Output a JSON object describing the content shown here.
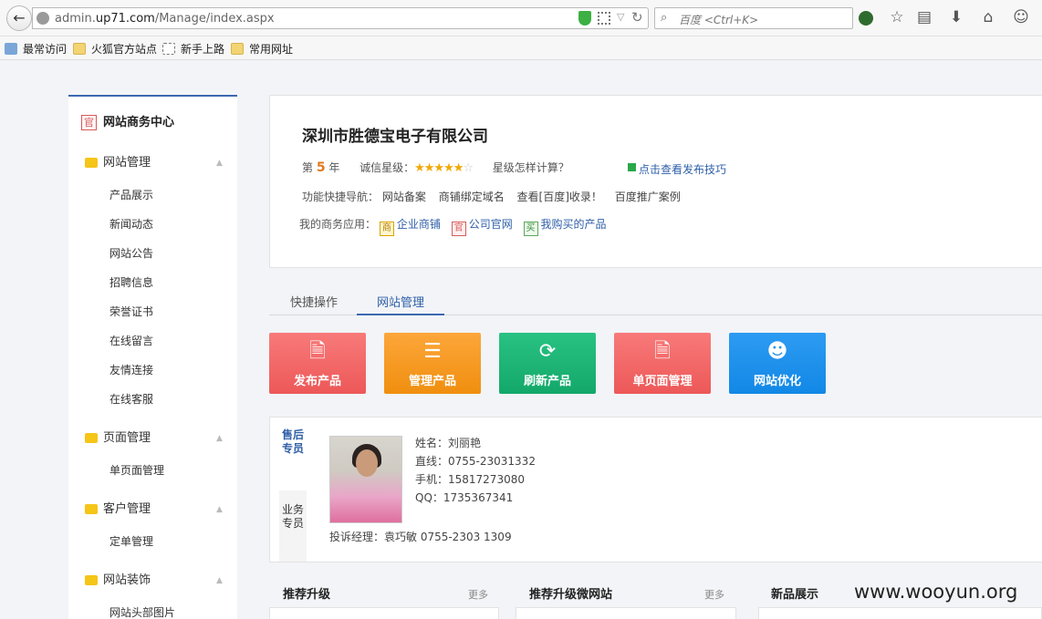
{
  "browser": {
    "url_prefix": "admin.",
    "url_domain": "up71.com",
    "url_path": "/Manage/index.aspx",
    "search_placeholder": "百度 <Ctrl+K>",
    "bookmarks": [
      "最常访问",
      "火狐官方站点",
      "新手上路",
      "常用网址"
    ]
  },
  "sidebar": {
    "title": "网站商务中心",
    "title_icon": "官",
    "sections": [
      {
        "label": "网站管理",
        "items": [
          "产品展示",
          "新闻动态",
          "网站公告",
          "招聘信息",
          "荣誉证书",
          "在线留言",
          "友情连接",
          "在线客服"
        ]
      },
      {
        "label": "页面管理",
        "items": [
          "单页面管理"
        ]
      },
      {
        "label": "客户管理",
        "items": [
          "定单管理"
        ]
      },
      {
        "label": "网站装饰",
        "items": [
          "网站头部图片"
        ]
      }
    ]
  },
  "company": {
    "name": "深圳市胜德宝电子有限公司",
    "year_prefix": "第",
    "year_num": "5",
    "year_suffix": "年",
    "rating_label": "诚信星级：",
    "rating_stars": 5,
    "rating_total": 6,
    "star_calc": "星级怎样计算？",
    "tips_link": "点击查看发布技巧",
    "nav_label": "功能快捷导航：",
    "nav_links": [
      "网站备案",
      "商铺绑定域名",
      "查看[百度]收录！",
      "百度推广案例"
    ],
    "apps_label": "我的商务应用：",
    "apps": [
      {
        "icon": "商",
        "label": "企业商铺"
      },
      {
        "icon": "官",
        "label": "公司官网"
      },
      {
        "icon": "买",
        "label": "我购买的产品"
      }
    ]
  },
  "tabs": [
    "快捷操作",
    "网站管理"
  ],
  "actions": [
    {
      "label": "发布产品",
      "icon": "document-icon",
      "glyph": "🗎",
      "color": "#f06a6a"
    },
    {
      "label": "管理产品",
      "icon": "list-icon",
      "glyph": "☰",
      "color": "#f59a1c"
    },
    {
      "label": "刷新产品",
      "icon": "refresh-icon",
      "glyph": "⟳",
      "color": "#1eb577"
    },
    {
      "label": "单页面管理",
      "icon": "document-icon",
      "glyph": "🗎",
      "color": "#f06a6a"
    },
    {
      "label": "网站优化",
      "icon": "qq-penguin-icon",
      "glyph": "☻",
      "color": "#1c8fec"
    }
  ],
  "staff": {
    "after_sales_tab": "售后专员",
    "business_tab": "业务专员",
    "info": [
      "姓名：刘丽艳",
      "直线：0755-23031332",
      "手机：15817273080",
      "QQ：1735367341"
    ],
    "complaint": "投诉经理：袁巧敏 0755-2303 1309"
  },
  "bottom_panels": [
    {
      "title": "推荐升级",
      "more": "更多"
    },
    {
      "title": "推荐升级微网站",
      "more": "更多"
    },
    {
      "title": "新品展示",
      "more": ""
    }
  ],
  "watermark": "www.wooyun.org"
}
